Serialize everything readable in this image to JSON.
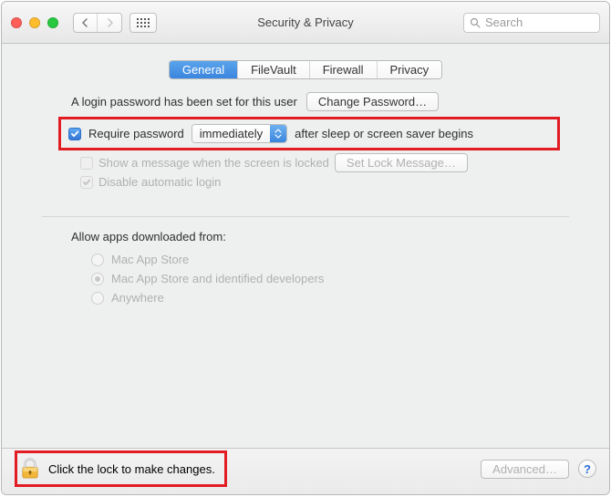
{
  "titlebar": {
    "title": "Security & Privacy",
    "search_placeholder": "Search"
  },
  "tabs": {
    "general": "General",
    "filevault": "FileVault",
    "firewall": "Firewall",
    "privacy": "Privacy"
  },
  "general": {
    "login_password_set": "A login password has been set for this user",
    "change_password_button": "Change Password…",
    "require_password_label_pre": "Require password",
    "require_password_select_value": "immediately",
    "require_password_label_post": "after sleep or screen saver begins",
    "show_message_label": "Show a message when the screen is locked",
    "set_lock_message_button": "Set Lock Message…",
    "disable_auto_login_label": "Disable automatic login"
  },
  "allow": {
    "title": "Allow apps downloaded from:",
    "opt1": "Mac App Store",
    "opt2": "Mac App Store and identified developers",
    "opt3": "Anywhere"
  },
  "footer": {
    "lock_text": "Click the lock to make changes.",
    "advanced_button": "Advanced…",
    "help": "?"
  }
}
